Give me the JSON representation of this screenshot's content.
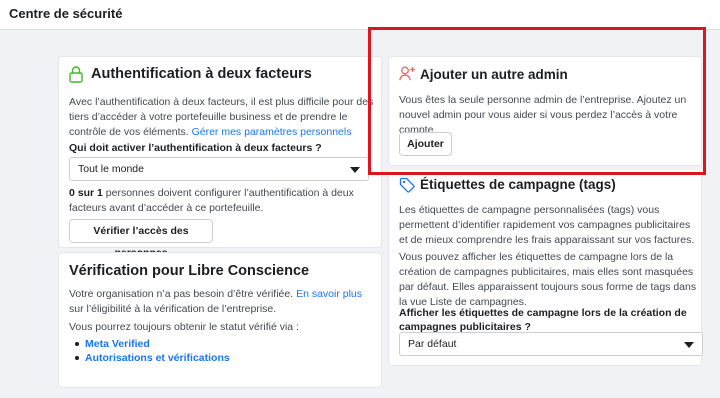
{
  "page": {
    "title": "Centre de sécurité"
  },
  "two_factor": {
    "title": "Authentification à deux facteurs",
    "description": "Avec l’authentification à deux facteurs, il est plus difficile pour des tiers d’accéder à votre portefeuille business et de prendre le contrôle de vos éléments.",
    "link": "Gérer mes paramètres personnels",
    "question": "Qui doit activer l’authentification à deux facteurs ?",
    "select_value": "Tout le monde",
    "count_bold": "0 sur 1",
    "count_text": " personnes doivent configurer l’authentification à deux facteurs avant d’accéder à ce portefeuille.",
    "button": "Vérifier l’accès des personnes"
  },
  "verification": {
    "title": "Vérification pour Libre Conscience",
    "text_before": "Votre organisation n’a pas besoin d’être vérifiée.",
    "link": "En savoir plus",
    "text_after": " sur l’éligibilité à la vérification de l’entreprise.",
    "status_text": "Vous pourrez toujours obtenir le statut vérifié via :",
    "items": [
      "Meta Verified",
      "Autorisations et vérifications"
    ]
  },
  "add_admin": {
    "title": "Ajouter un autre admin",
    "description": "Vous êtes la seule personne admin de l’entreprise. Ajoutez un nouvel admin pour vous aider si vous perdez l’accès à votre compte.",
    "button": "Ajouter"
  },
  "campaign_tags": {
    "title": "Étiquettes de campagne (tags)",
    "para1": "Les étiquettes de campagne personnalisées (tags) vous permettent d’identifier rapidement vos campagnes publicitaires et de mieux comprendre les frais apparaissant sur vos factures.",
    "para2": "Vous pouvez afficher les étiquettes de campagne lors de la création de campagnes publicitaires, mais elles sont masquées par défaut. Elles apparaissent toujours sous forme de tags dans la vue Liste de campagnes.",
    "question": "Afficher les étiquettes de campagne lors de la création de campagnes publicitaires ?",
    "select_value": "Par défaut"
  },
  "colors": {
    "link": "#1877f2",
    "highlight": "#e0141e",
    "lock_icon": "#42b72a",
    "admin_icon": "#e86a6a",
    "tag_icon": "#1877f2"
  }
}
